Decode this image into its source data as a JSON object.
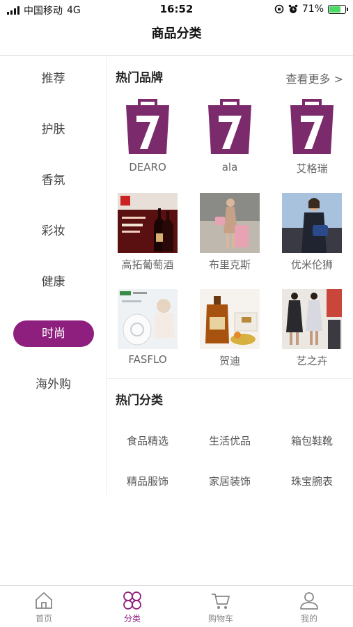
{
  "status_bar": {
    "carrier": "中国移动",
    "network": "4G",
    "time": "16:52",
    "battery": "71%",
    "battery_level": 0.71
  },
  "nav": {
    "title": "商品分类"
  },
  "sidebar": {
    "items": [
      {
        "label": "推荐"
      },
      {
        "label": "护肤"
      },
      {
        "label": "香氛"
      },
      {
        "label": "彩妆"
      },
      {
        "label": "健康"
      },
      {
        "label": "时尚",
        "active": true
      },
      {
        "label": "海外购"
      }
    ]
  },
  "hot_brands": {
    "title": "热门品牌",
    "more": "查看更多 >",
    "brands": [
      {
        "name": "DEARO",
        "image": "seven-bag-logo"
      },
      {
        "name": "ala",
        "image": "seven-bag-logo"
      },
      {
        "name": "艾格瑞",
        "image": "seven-bag-logo"
      },
      {
        "name": "高拓葡萄酒",
        "image": "wine-bottle-photo"
      },
      {
        "name": "布里克斯",
        "image": "luggage-model-photo"
      },
      {
        "name": "优米伦狮",
        "image": "handbag-model-photo"
      },
      {
        "name": "FASFLO",
        "image": "humidifier-photo"
      },
      {
        "name": "贺迪",
        "image": "liquor-bottle-photo"
      },
      {
        "name": "艺之卉",
        "image": "fashion-models-photo"
      }
    ]
  },
  "hot_categories": {
    "title": "热门分类",
    "items": [
      {
        "label": "食品精选"
      },
      {
        "label": "生活优品"
      },
      {
        "label": "箱包鞋靴"
      },
      {
        "label": "精品服饰"
      },
      {
        "label": "家居装饰"
      },
      {
        "label": "珠宝腕表"
      }
    ]
  },
  "tab_bar": {
    "tabs": [
      {
        "label": "首页",
        "icon": "home-icon"
      },
      {
        "label": "分类",
        "icon": "category-icon",
        "active": true
      },
      {
        "label": "购物车",
        "icon": "cart-icon"
      },
      {
        "label": "我的",
        "icon": "user-icon"
      }
    ]
  },
  "colors": {
    "accent": "#8f1f7e",
    "logo_purple": "#7b2a6b"
  }
}
